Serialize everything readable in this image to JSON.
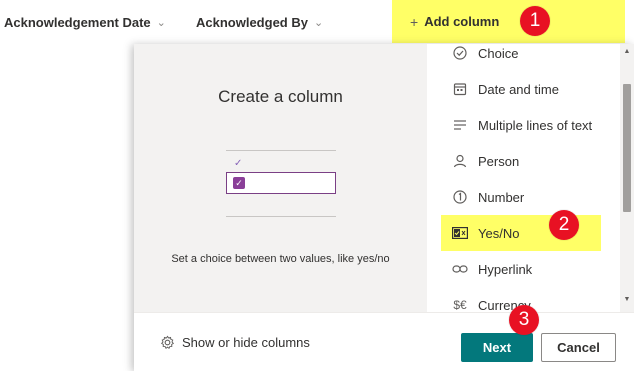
{
  "header": {
    "columns": [
      {
        "label": "Acknowledgement Date"
      },
      {
        "label": "Acknowledged By"
      }
    ],
    "add_column_label": "Add column",
    "highlight_color": "#ffff66"
  },
  "callouts": [
    "1",
    "2",
    "3"
  ],
  "panel": {
    "title": "Create a column",
    "description": "Set a choice between two values, like yes/no",
    "column_types": [
      {
        "label": "Choice",
        "icon": "choice-icon"
      },
      {
        "label": "Date and time",
        "icon": "calendar-icon"
      },
      {
        "label": "Multiple lines of text",
        "icon": "multiline-text-icon"
      },
      {
        "label": "Person",
        "icon": "person-icon"
      },
      {
        "label": "Number",
        "icon": "number-icon"
      },
      {
        "label": "Yes/No",
        "icon": "yes-no-icon",
        "selected": true
      },
      {
        "label": "Hyperlink",
        "icon": "link-icon"
      },
      {
        "label": "Currency",
        "icon": "currency-icon"
      }
    ],
    "footer": {
      "show_hide_label": "Show or hide columns",
      "next_label": "Next",
      "cancel_label": "Cancel"
    }
  },
  "colors": {
    "accent": "#03787c",
    "callout": "#e81123",
    "preview_purple": "#8a3f98"
  }
}
